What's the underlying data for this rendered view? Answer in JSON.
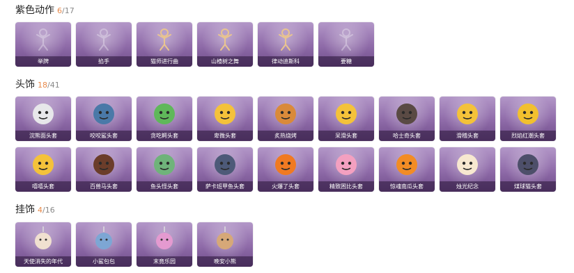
{
  "sections": [
    {
      "title": "紫色动作",
      "owned": "6",
      "total": "/17",
      "items": [
        {
          "label": "举牌",
          "icon": "sign-pose-icon",
          "faded": true
        },
        {
          "label": "掐手",
          "icon": "pose-icon",
          "faded": true
        },
        {
          "label": "猫师进行曲",
          "icon": "dance-pose-icon",
          "faded": false
        },
        {
          "label": "山楂树之舞",
          "icon": "dance-pose-icon",
          "faded": false
        },
        {
          "label": "律动迪斯科",
          "icon": "disco-pose-icon",
          "faded": false
        },
        {
          "label": "要糖",
          "icon": "pose-icon",
          "faded": true
        }
      ]
    },
    {
      "title": "头饰",
      "owned": "18",
      "total": "/41",
      "items": [
        {
          "label": "浣熊面头套",
          "icon": "raccoon-head-icon"
        },
        {
          "label": "咬咬鲨头套",
          "icon": "shark-head-icon"
        },
        {
          "label": "贪吃鳄头套",
          "icon": "crocodile-head-icon"
        },
        {
          "label": "卑微头套",
          "icon": "sad-emoji-head-icon"
        },
        {
          "label": "炙热烧烤",
          "icon": "bbq-head-icon"
        },
        {
          "label": "呆滑头套",
          "icon": "emoji-head-icon"
        },
        {
          "label": "哈士奇头套",
          "icon": "husky-head-icon"
        },
        {
          "label": "滑稽头套",
          "icon": "funny-emoji-head-icon"
        },
        {
          "label": "烈焰红潮头套",
          "icon": "yellow-creature-head-icon"
        },
        {
          "label": "嘻嘻头套",
          "icon": "grin-emoji-head-icon"
        },
        {
          "label": "百兽马头套",
          "icon": "horse-head-icon"
        },
        {
          "label": "鱼头怪头套",
          "icon": "fish-head-icon"
        },
        {
          "label": "萨卡班甲鱼头套",
          "icon": "sakabanjia-fish-head-icon"
        },
        {
          "label": "火爆了头套",
          "icon": "fire-head-icon"
        },
        {
          "label": "精致困比头套",
          "icon": "pink-pig-head-icon"
        },
        {
          "label": "惊魂南瓜头套",
          "icon": "pumpkin-head-icon"
        },
        {
          "label": "烛光纪念",
          "icon": "candle-head-icon"
        },
        {
          "label": "煤球猫头套",
          "icon": "cat-head-icon"
        }
      ]
    },
    {
      "title": "挂饰",
      "owned": "4",
      "total": "/16",
      "items": [
        {
          "label": "天使消失的年代",
          "icon": "angel-pendant-icon"
        },
        {
          "label": "小鲨包包",
          "icon": "shark-bag-pendant-icon"
        },
        {
          "label": "末竟乐园",
          "icon": "clown-pendant-icon"
        },
        {
          "label": "晚安小熊",
          "icon": "bear-pendant-icon"
        }
      ]
    }
  ]
}
